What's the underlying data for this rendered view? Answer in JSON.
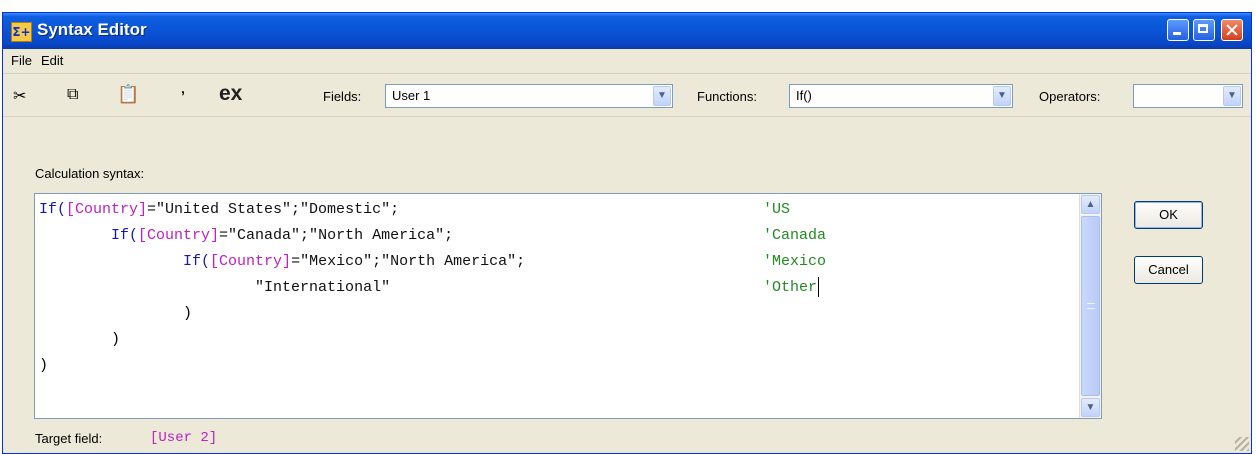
{
  "window": {
    "title": "Syntax Editor",
    "icon": "sigma-plus-icon"
  },
  "menu": {
    "items": [
      "File",
      "Edit"
    ]
  },
  "toolbar": {
    "icons": [
      "cut-icon",
      "copy-icon",
      "paste-icon",
      "comment-icon"
    ],
    "ex_label": "ex",
    "fields_label": "Fields:",
    "fields_value": "User 1",
    "functions_label": "Functions:",
    "functions_value": "If()",
    "operators_label": "Operators:",
    "operators_value": ""
  },
  "editor": {
    "label": "Calculation syntax:",
    "lines": [
      {
        "indent": "",
        "tokens": [
          {
            "t": "kw",
            "v": "If("
          },
          {
            "t": "fld",
            "v": "[Country]"
          },
          {
            "t": "str",
            "v": "=\"United States\";\"Domestic\";"
          }
        ],
        "comment": "'US"
      },
      {
        "indent": "        ",
        "tokens": [
          {
            "t": "kw",
            "v": "If("
          },
          {
            "t": "fld",
            "v": "[Country]"
          },
          {
            "t": "str",
            "v": "=\"Canada\";\"North America\";"
          }
        ],
        "comment": "'Canada"
      },
      {
        "indent": "                ",
        "tokens": [
          {
            "t": "kw",
            "v": "If("
          },
          {
            "t": "fld",
            "v": "[Country]"
          },
          {
            "t": "str",
            "v": "=\"Mexico\";\"North America\";"
          }
        ],
        "comment": "'Mexico"
      },
      {
        "indent": "                        ",
        "tokens": [
          {
            "t": "str",
            "v": "\"International\""
          }
        ],
        "comment": "'Other"
      },
      {
        "indent": "                ",
        "tokens": [
          {
            "t": "plain",
            "v": ")"
          }
        ],
        "comment": ""
      },
      {
        "indent": "        ",
        "tokens": [
          {
            "t": "plain",
            "v": ")"
          }
        ],
        "comment": ""
      },
      {
        "indent": "",
        "tokens": [
          {
            "t": "plain",
            "v": ")"
          }
        ],
        "comment": ""
      }
    ]
  },
  "buttons": {
    "ok": "OK",
    "cancel": "Cancel"
  },
  "target": {
    "label": "Target field:",
    "value": "[User 2]"
  }
}
